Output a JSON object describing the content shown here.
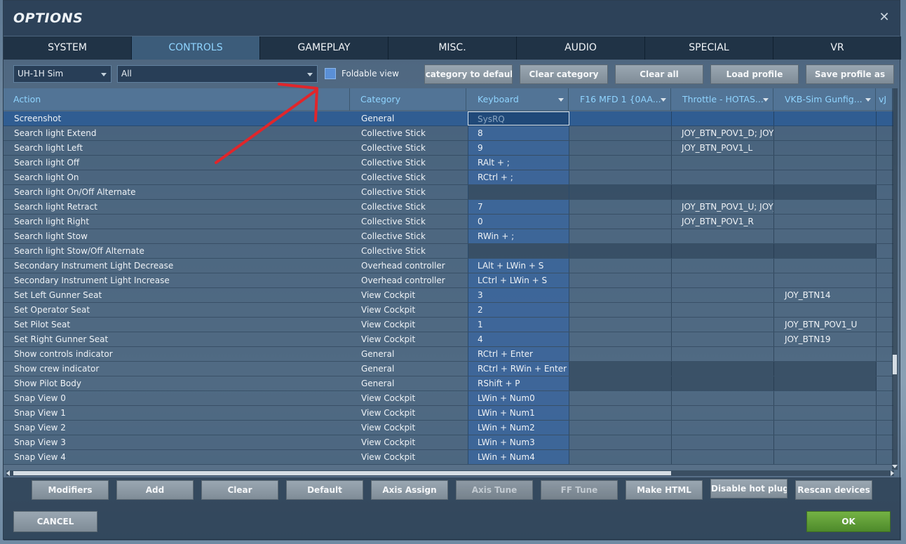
{
  "window": {
    "title": "OPTIONS",
    "close_label": "✕"
  },
  "tabs": [
    {
      "label": "SYSTEM"
    },
    {
      "label": "CONTROLS"
    },
    {
      "label": "GAMEPLAY"
    },
    {
      "label": "MISC."
    },
    {
      "label": "AUDIO"
    },
    {
      "label": "SPECIAL"
    },
    {
      "label": "VR"
    }
  ],
  "active_tab": "CONTROLS",
  "toolbar": {
    "aircraft_select": "UH-1H Sim",
    "category_select": "All",
    "foldable_label": "Foldable view",
    "set_category_label": "Set category to default",
    "clear_category_label": "Clear category",
    "clear_all_label": "Clear all",
    "load_profile_label": "Load profile",
    "save_profile_label": "Save profile as"
  },
  "columns": {
    "action": "Action",
    "category": "Category",
    "keyboard": "Keyboard",
    "f16": "F16 MFD 1 {0AA...",
    "throttle": "Throttle - HOTAS...",
    "vkb": "VKB-Sim Gunfig...",
    "vj": "vJ"
  },
  "rows": [
    {
      "action": "Screenshot",
      "category": "General",
      "keyboard": "SysRQ",
      "throttle": "",
      "vkb": ""
    },
    {
      "action": "Search light Extend",
      "category": "Collective Stick",
      "keyboard": "8",
      "throttle": "JOY_BTN_POV1_D; JOY_",
      "vkb": ""
    },
    {
      "action": "Search light Left",
      "category": "Collective Stick",
      "keyboard": "9",
      "throttle": "JOY_BTN_POV1_L",
      "vkb": ""
    },
    {
      "action": "Search light Off",
      "category": "Collective Stick",
      "keyboard": "RAlt + ;",
      "throttle": "",
      "vkb": ""
    },
    {
      "action": "Search light On",
      "category": "Collective Stick",
      "keyboard": "RCtrl + ;",
      "throttle": "",
      "vkb": ""
    },
    {
      "action": "Search light On/Off Alternate",
      "category": "Collective Stick",
      "keyboard": "",
      "throttle": "",
      "vkb": ""
    },
    {
      "action": "Search light Retract",
      "category": "Collective Stick",
      "keyboard": "7",
      "throttle": "JOY_BTN_POV1_U; JOY_",
      "vkb": ""
    },
    {
      "action": "Search light Right",
      "category": "Collective Stick",
      "keyboard": "0",
      "throttle": "JOY_BTN_POV1_R",
      "vkb": ""
    },
    {
      "action": "Search light Stow",
      "category": "Collective Stick",
      "keyboard": "RWin + ;",
      "throttle": "",
      "vkb": ""
    },
    {
      "action": "Search light Stow/Off Alternate",
      "category": "Collective Stick",
      "keyboard": "",
      "throttle": "",
      "vkb": ""
    },
    {
      "action": "Secondary Instrument Light Decrease",
      "category": "Overhead controller",
      "keyboard": "LAlt + LWin + S",
      "throttle": "",
      "vkb": ""
    },
    {
      "action": "Secondary Instrument Light Increase",
      "category": "Overhead controller",
      "keyboard": "LCtrl + LWin + S",
      "throttle": "",
      "vkb": ""
    },
    {
      "action": "Set Left Gunner Seat",
      "category": "View Cockpit",
      "keyboard": "3",
      "throttle": "",
      "vkb": "JOY_BTN14"
    },
    {
      "action": "Set Operator Seat",
      "category": "View Cockpit",
      "keyboard": "2",
      "throttle": "",
      "vkb": ""
    },
    {
      "action": "Set Pilot Seat",
      "category": "View Cockpit",
      "keyboard": "1",
      "throttle": "",
      "vkb": "JOY_BTN_POV1_U"
    },
    {
      "action": "Set Right Gunner Seat",
      "category": "View Cockpit",
      "keyboard": "4",
      "throttle": "",
      "vkb": "JOY_BTN19"
    },
    {
      "action": "Show controls indicator",
      "category": "General",
      "keyboard": "RCtrl + Enter",
      "throttle": "",
      "vkb": ""
    },
    {
      "action": "Show crew indicator",
      "category": "General",
      "keyboard": "RCtrl + RWin + Enter",
      "throttle": "",
      "vkb": ""
    },
    {
      "action": "Show Pilot Body",
      "category": "General",
      "keyboard": "RShift + P",
      "throttle": "",
      "vkb": ""
    },
    {
      "action": "Snap View 0",
      "category": "View Cockpit",
      "keyboard": "LWin + Num0",
      "throttle": "",
      "vkb": ""
    },
    {
      "action": "Snap View 1",
      "category": "View Cockpit",
      "keyboard": "LWin + Num1",
      "throttle": "",
      "vkb": ""
    },
    {
      "action": "Snap View 2",
      "category": "View Cockpit",
      "keyboard": "LWin + Num2",
      "throttle": "",
      "vkb": ""
    },
    {
      "action": "Snap View 3",
      "category": "View Cockpit",
      "keyboard": "LWin + Num3",
      "throttle": "",
      "vkb": ""
    },
    {
      "action": "Snap View 4",
      "category": "View Cockpit",
      "keyboard": "LWin + Num4",
      "throttle": "",
      "vkb": ""
    }
  ],
  "bottom_buttons": {
    "modifiers": "Modifiers",
    "add": "Add",
    "clear": "Clear",
    "default": "Default",
    "axis_assign": "Axis Assign",
    "axis_tune": "Axis Tune",
    "ff_tune": "FF Tune",
    "make_html": "Make HTML",
    "disable_hot_plug": "Disable hot plug",
    "rescan_devices": "Rescan devices"
  },
  "footer": {
    "cancel_label": "CANCEL",
    "ok_label": "OK"
  },
  "colors": {
    "accent": "#8fd4ff",
    "ok_green": "#5e9e34",
    "annotation_red": "#e0262b",
    "checkbox_blue": "#5a8fd6"
  }
}
